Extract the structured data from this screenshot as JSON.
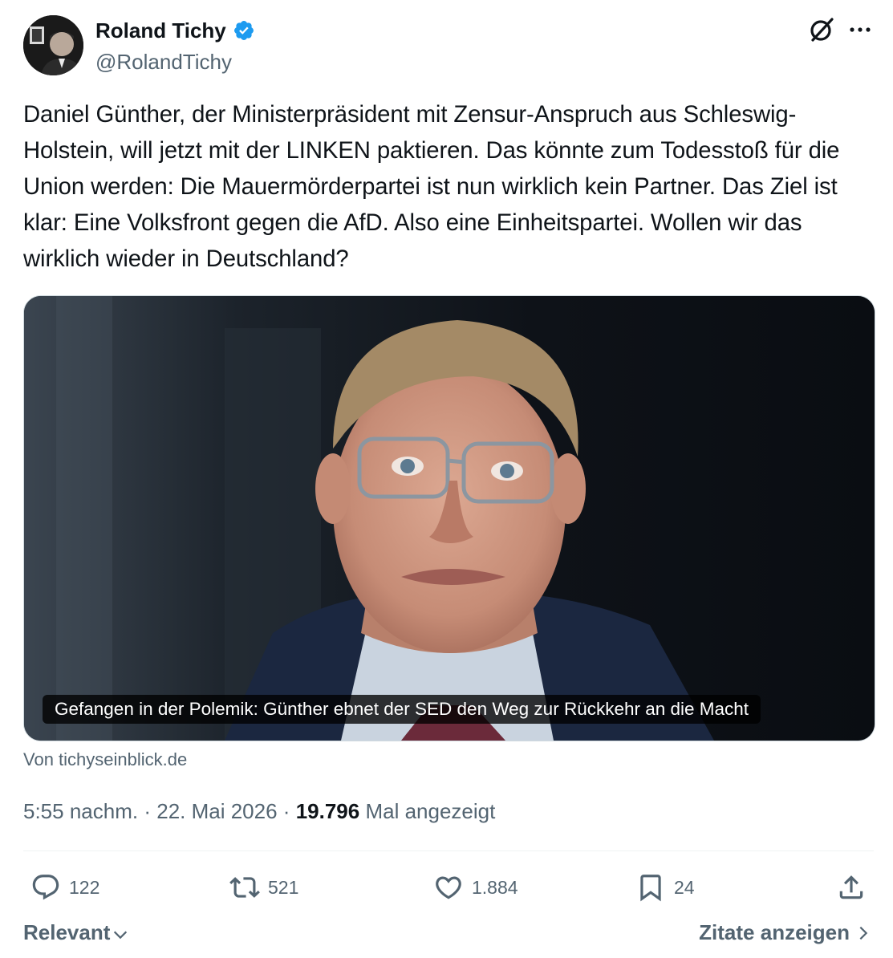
{
  "author": {
    "display_name": "Roland Tichy",
    "handle": "@RolandTichy",
    "verified": true
  },
  "tweet": {
    "text": "Daniel Günther, der Ministerpräsident mit Zensur-Anspruch aus Schleswig-Holstein, will jetzt mit der LINKEN paktieren. Das könnte zum Todesstoß für die Union werden: Die Mauermörderpartei ist nun wirklich kein Partner. Das Ziel ist klar: Eine Volksfront gegen die AfD. Also eine Einheitspartei. Wollen wir das wirklich wieder in Deutschland?"
  },
  "card": {
    "caption": "Gefangen in der Polemik: Günther ebnet der SED den Weg zur Rückkehr an die Macht",
    "source": "Von tichyseinblick.de"
  },
  "meta": {
    "time": "5:55 nachm.",
    "separator": "·",
    "date": "22. Mai 2026",
    "views_count": "19.796",
    "views_label": "Mal angezeigt"
  },
  "actions": {
    "replies": "122",
    "reposts": "521",
    "likes": "1.884",
    "bookmarks": "24"
  },
  "footer": {
    "sort_label": "Relevant",
    "quotes_label": "Zitate anzeigen"
  },
  "colors": {
    "text_primary": "#0f1419",
    "text_secondary": "#536471",
    "verified_blue": "#1d9bf0",
    "divider": "#eff3f4"
  },
  "icons": [
    "verified-badge-icon",
    "grok-icon",
    "more-icon",
    "reply-icon",
    "repost-icon",
    "like-icon",
    "bookmark-icon",
    "share-icon",
    "chevron-down-icon",
    "chevron-right-icon"
  ]
}
